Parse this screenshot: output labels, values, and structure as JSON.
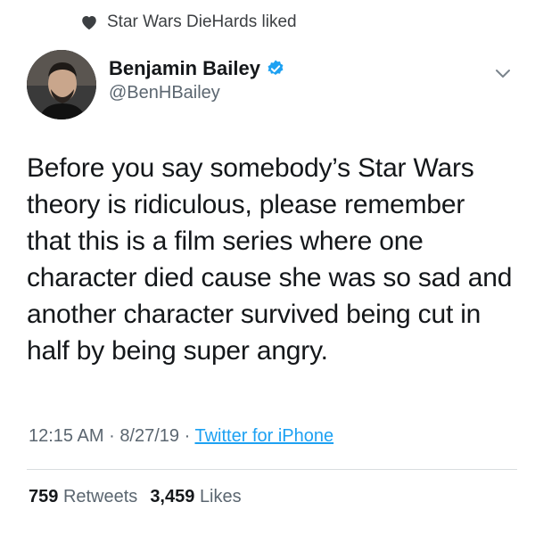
{
  "context": {
    "text": "Star Wars DieHards liked",
    "icon": "heart-icon"
  },
  "author": {
    "display_name": "Benjamin Bailey",
    "handle": "@BenHBailey",
    "verified": true,
    "verified_color": "#1da1f2"
  },
  "tweet": {
    "text": "Before you say somebody’s Star Wars theory is ridiculous, please remember that this is a film series where one character died cause she was so sad and another character survived being cut in half by being super angry."
  },
  "meta": {
    "time": "12:15 AM",
    "separator": "·",
    "date": "8/27/19",
    "source": "Twitter for iPhone"
  },
  "stats": {
    "retweets_count": "759",
    "retweets_label": "Retweets",
    "likes_count": "3,459",
    "likes_label": "Likes"
  },
  "colors": {
    "link": "#1da1f2",
    "muted": "#5b6670",
    "text": "#14171a"
  }
}
